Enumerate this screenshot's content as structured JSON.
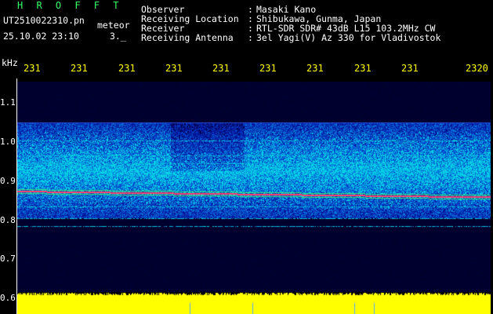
{
  "header": {
    "logo_text": "H R O F F T",
    "filename": "UT2510022310.pn",
    "mode": "meteor",
    "datetime": "25.10.02 23:10",
    "datetime_suffix": "3._",
    "fields": [
      {
        "label": "Observer",
        "value": "Masaki Kano"
      },
      {
        "label": "Receiving Location",
        "value": "Shibukawa, Gunma, Japan"
      },
      {
        "label": "Receiver",
        "value": "RTL-SDR SDR# 43dB L15 103.2MHz CW"
      },
      {
        "label": "Receiving Antenna",
        "value": "3el Yagi(V) Az 330 for Vladivostok"
      }
    ]
  },
  "axis": {
    "unit": "kHz",
    "x_ticks": [
      "231",
      "231",
      "231",
      "231",
      "231",
      "231",
      "231",
      "231",
      "231",
      "2320"
    ],
    "y_ticks": [
      "1.1",
      "1.0",
      "0.9",
      "0.8",
      "0.7",
      "0.6"
    ]
  },
  "colors": {
    "background": "#000000",
    "header_text": "#ffffff",
    "logo_text": "#33ff66",
    "time_text": "#ffff00",
    "amplitude": "#ffff00",
    "carrier": "#ff3355"
  },
  "spectrogram": {
    "carrier_khz_start": 0.86,
    "carrier_khz_end": 0.845,
    "band_top_khz": 1.035,
    "band_bottom_khz": 0.79
  }
}
